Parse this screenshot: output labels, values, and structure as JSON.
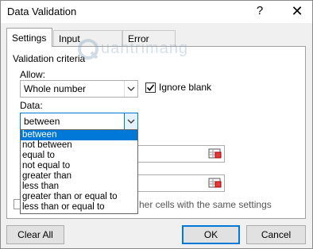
{
  "window": {
    "title": "Data Validation",
    "help_glyph": "?",
    "close_glyph": "✕"
  },
  "tabs": [
    {
      "label": "Settings"
    },
    {
      "label": "Input Message"
    },
    {
      "label": "Error Alert"
    }
  ],
  "settings": {
    "section_label": "Validation criteria",
    "allow_label": "Allow:",
    "allow_value": "Whole number",
    "ignore_blank_label": "Ignore blank",
    "ignore_blank_checked": true,
    "data_label": "Data:",
    "data_value": "between",
    "data_options": [
      "between",
      "not between",
      "equal to",
      "not equal to",
      "greater than",
      "less than",
      "greater than or equal to",
      "less than or equal to"
    ],
    "selected_option_index": 0,
    "apply_all_partial_label": "her cells with the same settings"
  },
  "watermark": {
    "text": "uantrimang"
  },
  "buttons": {
    "clear_all": "Clear All",
    "ok": "OK",
    "cancel": "Cancel"
  },
  "colors": {
    "accent": "#0078d7",
    "dialog_bg": "#f0f0f0",
    "panel_bg": "#ffffff"
  }
}
